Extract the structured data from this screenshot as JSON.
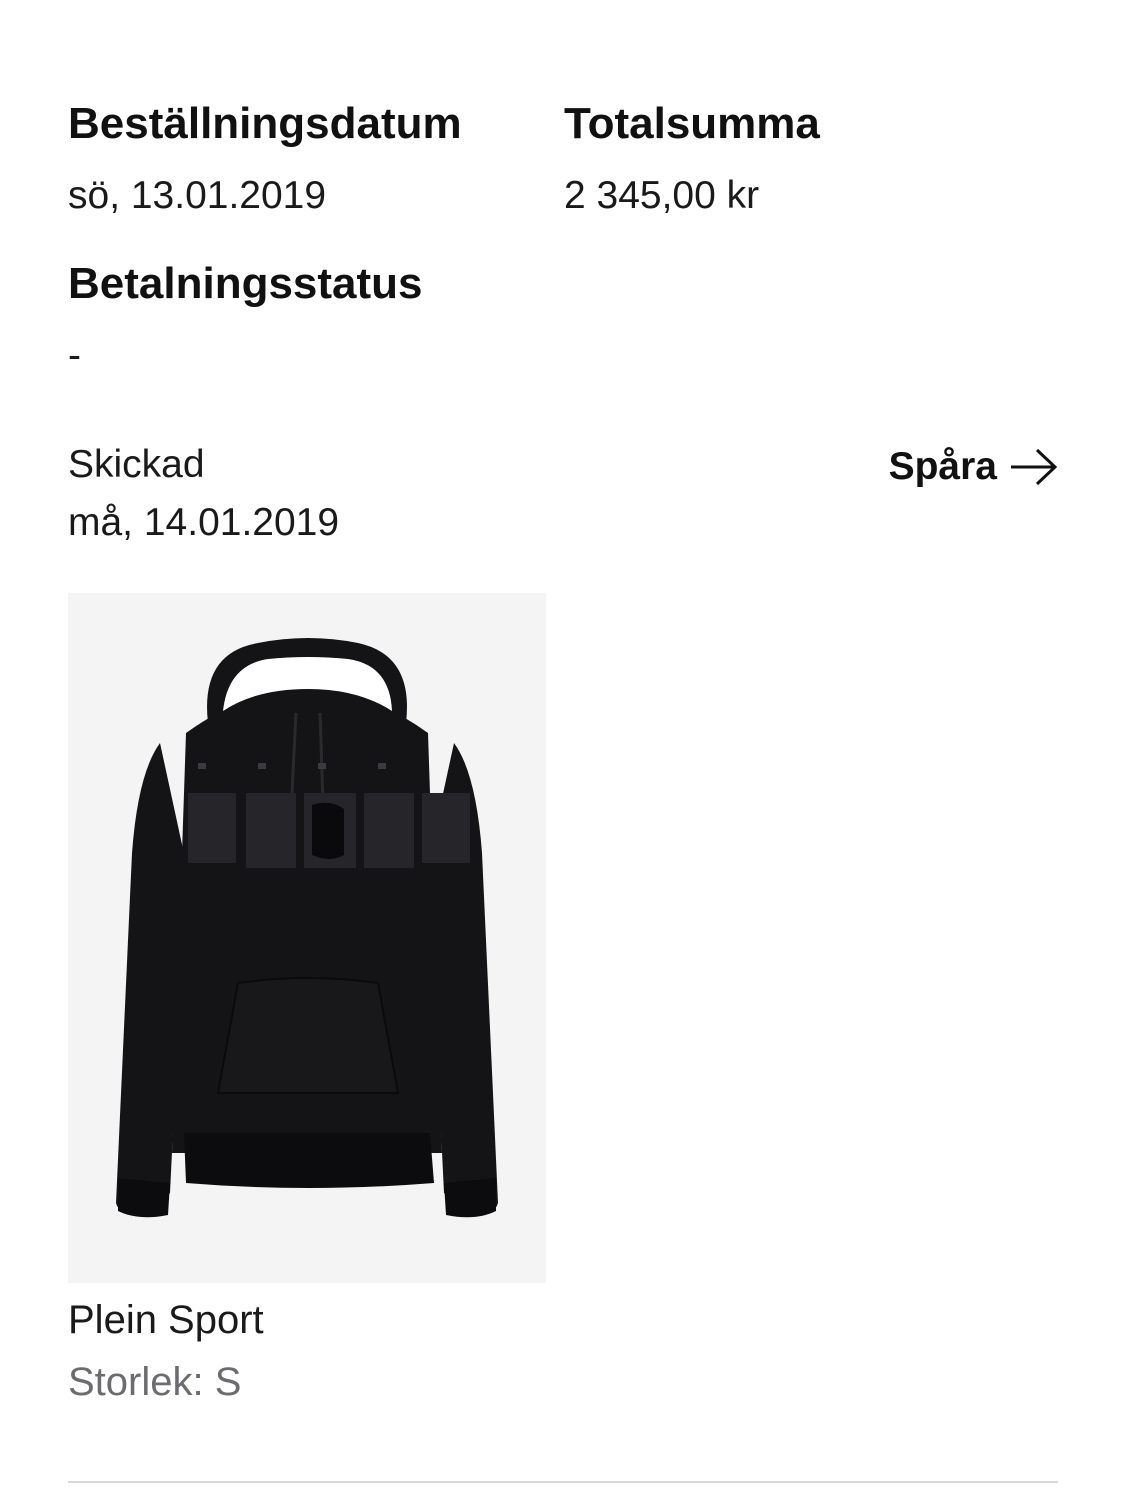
{
  "order": {
    "date_label": "Beställningsdatum",
    "date_value": "sö, 13.01.2019",
    "total_label": "Totalsumma",
    "total_value": "2 345,00 kr",
    "payment_label": "Betalningsstatus",
    "payment_value": "-"
  },
  "shipment": {
    "status": "Skickad",
    "date": "må, 14.01.2019",
    "track_label": "Spåra",
    "track_icon": "arrow-right-icon"
  },
  "product": {
    "image_icon": "hoodie-product-image",
    "name": "Plein Sport",
    "size_label": "Storlek:",
    "size_value": "S"
  },
  "colors": {
    "text": "#1a1a1a",
    "muted": "#6b6b70",
    "image_bg": "#f4f4f5",
    "divider": "#d8d8dc"
  }
}
